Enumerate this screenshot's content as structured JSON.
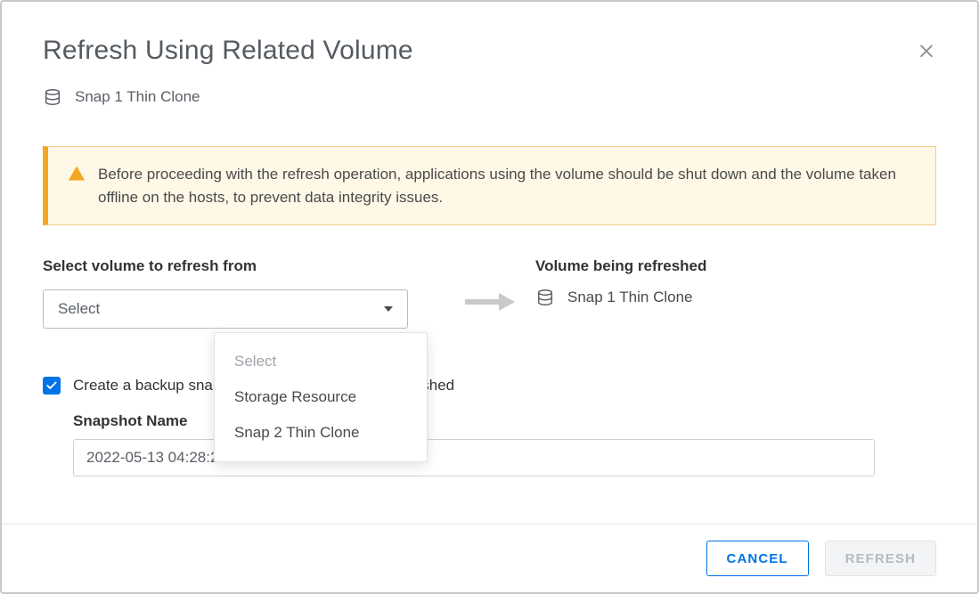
{
  "title": "Refresh Using Related Volume",
  "volume_name": "Snap 1 Thin Clone",
  "warning_text": "Before proceeding with the refresh operation, applications using the volume should be shut down and the volume taken offline on the hosts, to prevent data integrity issues.",
  "select_label": "Select volume to refresh from",
  "select_value": "Select",
  "dropdown": {
    "placeholder": "Select",
    "option1": "Storage Resource",
    "option2": "Snap 2 Thin Clone"
  },
  "refreshed_label": "Volume being refreshed",
  "refreshed_volume": "Snap 1 Thin Clone",
  "backup_checkbox_label": "Create a backup snapshot of the volume being refreshed",
  "snapshot_name_label": "Snapshot Name",
  "snapshot_name_value": "2022-05-13 04:28:29 PM UTC -04:00",
  "buttons": {
    "cancel": "CANCEL",
    "refresh": "REFRESH"
  }
}
